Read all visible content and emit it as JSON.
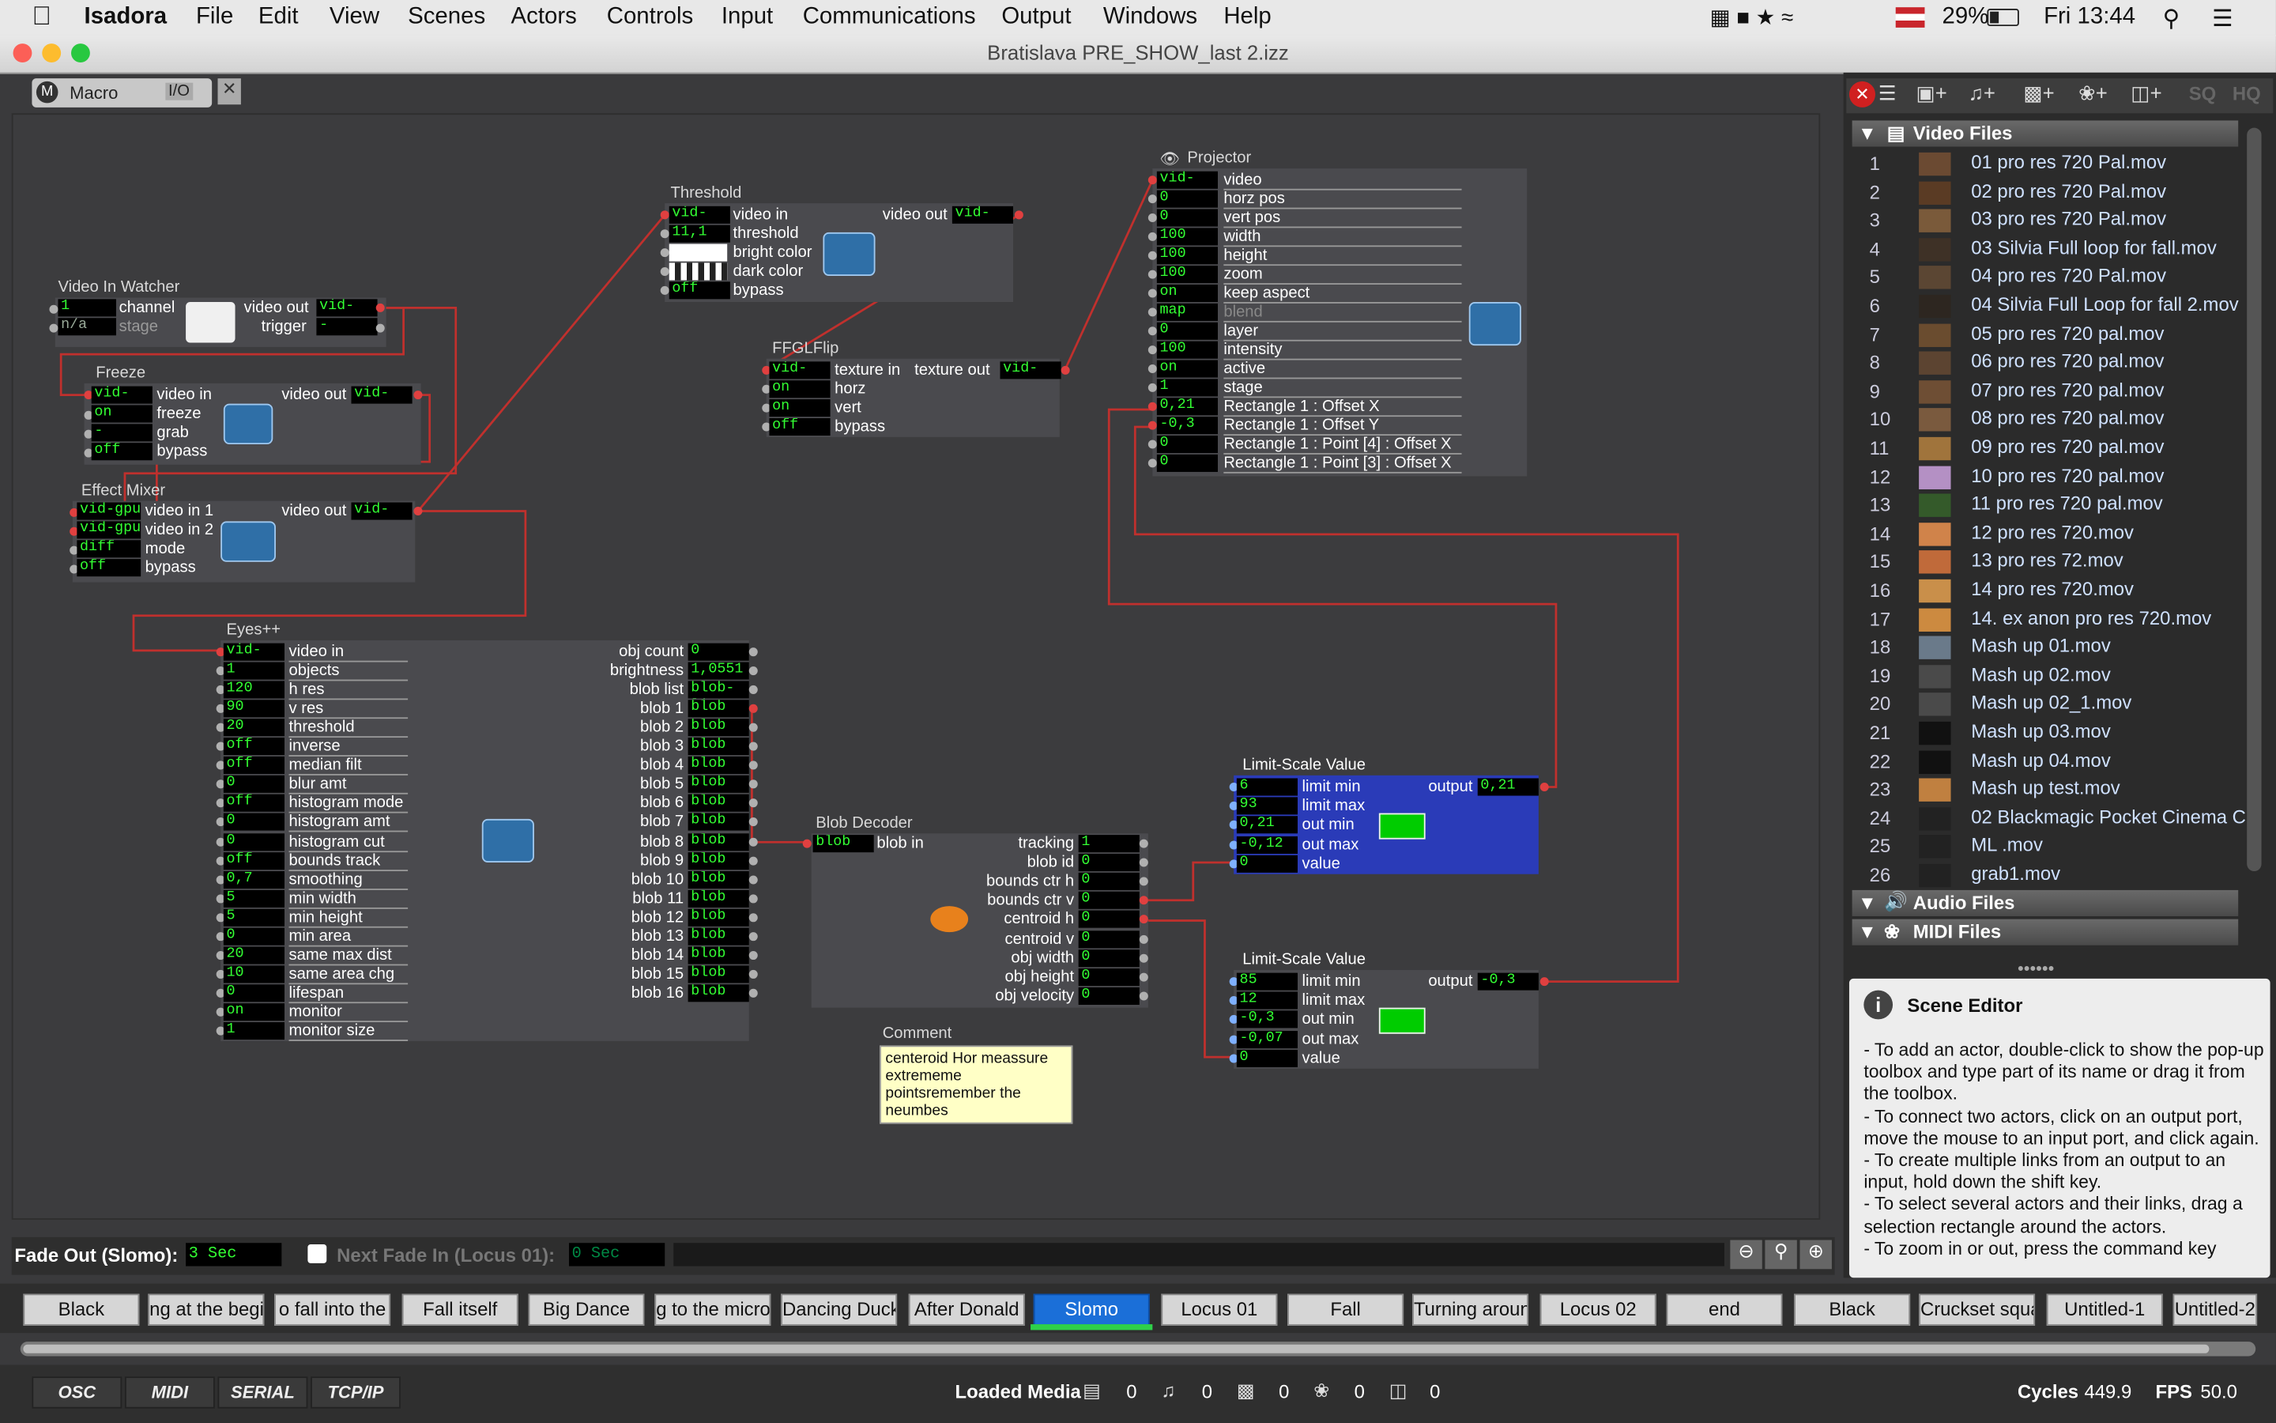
{
  "menubar": {
    "app": "Isadora",
    "items": [
      "File",
      "Edit",
      "View",
      "Scenes",
      "Actors",
      "Controls",
      "Input",
      "Communications",
      "Output",
      "Windows",
      "Help"
    ],
    "battery": "29%",
    "clock": "Fri 13:44"
  },
  "window": {
    "title": "Bratislava PRE_SHOW_last 2.izz"
  },
  "macro_tab": {
    "label": "Macro",
    "io": "I/O"
  },
  "actors": {
    "video_in_watcher": {
      "title": "Video In Watcher",
      "ch_val": "1",
      "ch_lbl": "channel",
      "stage_val": "n/a",
      "stage_lbl": "stage",
      "out_lbl": "video out",
      "out_val": "vid-gpu",
      "trig_lbl": "trigger",
      "trig_val": "-"
    },
    "freeze": {
      "title": "Freeze",
      "in_val": "vid-gpu",
      "in_lbl": "video in",
      "out_lbl": "video out",
      "out_val": "vid-gpu",
      "frz_val": "on",
      "frz_lbl": "freeze",
      "grab_val": "-",
      "grab_lbl": "grab",
      "byp_val": "off",
      "byp_lbl": "bypass"
    },
    "effect_mixer": {
      "title": "Effect Mixer",
      "in1_val": "vid-gpu",
      "in1_lbl": "video in 1",
      "in2_val": "vid-gpu",
      "in2_lbl": "video in 2",
      "mode_val": "diff",
      "mode_lbl": "mode",
      "byp_val": "off",
      "byp_lbl": "bypass",
      "out_lbl": "video out",
      "out_val": "vid-gpu"
    },
    "threshold": {
      "title": "Threshold",
      "in_val": "vid-gpu",
      "in_lbl": "video in",
      "thr_val": "11,1",
      "thr_lbl": "threshold",
      "bc_lbl": "bright color",
      "dc_lbl": "dark color",
      "byp_val": "off",
      "byp_lbl": "bypass",
      "out_lbl": "video out",
      "out_val": "vid-gpu"
    },
    "ffglflip": {
      "title": "FFGLFlip",
      "in_val": "vid-gpu",
      "in_lbl": "texture in",
      "h_val": "on",
      "h_lbl": "horz",
      "v_val": "on",
      "v_lbl": "vert",
      "byp_val": "off",
      "byp_lbl": "bypass",
      "out_lbl": "texture out",
      "out_val": "vid-gpu"
    },
    "projector": {
      "title": "Projector",
      "rows": [
        {
          "v": "vid-gpu",
          "l": "video"
        },
        {
          "v": "0",
          "l": "horz pos"
        },
        {
          "v": "0",
          "l": "vert pos"
        },
        {
          "v": "100",
          "l": "width"
        },
        {
          "v": "100",
          "l": "height"
        },
        {
          "v": "100",
          "l": "zoom"
        },
        {
          "v": "on",
          "l": "keep aspect"
        },
        {
          "v": "map",
          "l": "blend"
        },
        {
          "v": "0",
          "l": "layer"
        },
        {
          "v": "100",
          "l": "intensity"
        },
        {
          "v": "on",
          "l": "active"
        },
        {
          "v": "1",
          "l": "stage"
        },
        {
          "v": "0,21",
          "l": "Rectangle 1 : Offset X"
        },
        {
          "v": "-0,3",
          "l": "Rectangle 1 : Offset Y"
        },
        {
          "v": "0",
          "l": "Rectangle 1 : Point [4] : Offset X"
        },
        {
          "v": "0",
          "l": "Rectangle 1 : Point [3] : Offset X"
        }
      ]
    },
    "eyes": {
      "title": "Eyes++",
      "inputs": [
        {
          "v": "vid-gpu",
          "l": "video in"
        },
        {
          "v": "1",
          "l": "objects"
        },
        {
          "v": "120",
          "l": "h res"
        },
        {
          "v": "90",
          "l": "v res"
        },
        {
          "v": "20",
          "l": "threshold"
        },
        {
          "v": "off",
          "l": "inverse"
        },
        {
          "v": "off",
          "l": "median filt"
        },
        {
          "v": "0",
          "l": "blur amt"
        },
        {
          "v": "off",
          "l": "histogram mode"
        },
        {
          "v": "0",
          "l": "histogram amt"
        },
        {
          "v": "0",
          "l": "histogram cut"
        },
        {
          "v": "off",
          "l": "bounds track"
        },
        {
          "v": "0,7",
          "l": "smoothing"
        },
        {
          "v": "5",
          "l": "min width"
        },
        {
          "v": "5",
          "l": "min height"
        },
        {
          "v": "0",
          "l": "min area"
        },
        {
          "v": "20",
          "l": "same max dist"
        },
        {
          "v": "10",
          "l": "same area chg"
        },
        {
          "v": "0",
          "l": "lifespan"
        },
        {
          "v": "on",
          "l": "monitor"
        },
        {
          "v": "1",
          "l": "monitor size"
        }
      ],
      "outputs": [
        {
          "l": "obj count",
          "v": "0"
        },
        {
          "l": "brightness",
          "v": "1,0551"
        },
        {
          "l": "blob list",
          "v": "blob-list"
        },
        {
          "l": "blob 1",
          "v": "blob"
        },
        {
          "l": "blob 2",
          "v": "blob"
        },
        {
          "l": "blob 3",
          "v": "blob"
        },
        {
          "l": "blob 4",
          "v": "blob"
        },
        {
          "l": "blob 5",
          "v": "blob"
        },
        {
          "l": "blob 6",
          "v": "blob"
        },
        {
          "l": "blob 7",
          "v": "blob"
        },
        {
          "l": "blob 8",
          "v": "blob"
        },
        {
          "l": "blob 9",
          "v": "blob"
        },
        {
          "l": "blob 10",
          "v": "blob"
        },
        {
          "l": "blob 11",
          "v": "blob"
        },
        {
          "l": "blob 12",
          "v": "blob"
        },
        {
          "l": "blob 13",
          "v": "blob"
        },
        {
          "l": "blob 14",
          "v": "blob"
        },
        {
          "l": "blob 15",
          "v": "blob"
        },
        {
          "l": "blob 16",
          "v": "blob"
        }
      ]
    },
    "blob_decoder": {
      "title": "Blob Decoder",
      "in_val": "blob",
      "in_lbl": "blob in",
      "outputs": [
        {
          "l": "tracking",
          "v": "1"
        },
        {
          "l": "blob id",
          "v": "0"
        },
        {
          "l": "bounds ctr h",
          "v": "0"
        },
        {
          "l": "bounds ctr v",
          "v": "0"
        },
        {
          "l": "centroid h",
          "v": "0"
        },
        {
          "l": "centroid v",
          "v": "0"
        },
        {
          "l": "obj width",
          "v": "0"
        },
        {
          "l": "obj height",
          "v": "0"
        },
        {
          "l": "obj velocity",
          "v": "0"
        }
      ]
    },
    "limit_scale_1": {
      "title": "Limit-Scale Value",
      "rows": [
        {
          "v": "6",
          "l": "limit min"
        },
        {
          "v": "93",
          "l": "limit max"
        },
        {
          "v": "0,21",
          "l": "out min"
        },
        {
          "v": "-0,12",
          "l": "out max"
        },
        {
          "v": "0",
          "l": "value"
        }
      ],
      "out_lbl": "output",
      "out_val": "0,21"
    },
    "limit_scale_2": {
      "title": "Limit-Scale Value",
      "rows": [
        {
          "v": "85",
          "l": "limit min"
        },
        {
          "v": "12",
          "l": "limit max"
        },
        {
          "v": "-0,3",
          "l": "out min"
        },
        {
          "v": "-0,07",
          "l": "out max"
        },
        {
          "v": "0",
          "l": "value"
        }
      ],
      "out_lbl": "output",
      "out_val": "-0,3"
    },
    "comment": {
      "title": "Comment",
      "text": "centeroid Hor meassure extrememe pointsremember the neumbes"
    }
  },
  "fade": {
    "out_label": "Fade Out (Slomo):",
    "out_val": "3 Sec",
    "next_label": "Next Fade In (Locus 01):",
    "next_val": "0 Sec"
  },
  "media": {
    "video_header": "Video Files",
    "videos": [
      {
        "n": "1",
        "name": "01 pro res 720 Pal.mov"
      },
      {
        "n": "2",
        "name": "02 pro res 720 Pal.mov"
      },
      {
        "n": "3",
        "name": "03 pro res 720 Pal.mov"
      },
      {
        "n": "4",
        "name": "03 Silvia Full loop for fall.mov"
      },
      {
        "n": "5",
        "name": "04 pro res 720 Pal.mov"
      },
      {
        "n": "6",
        "name": "04 Silvia Full Loop for fall 2.mov"
      },
      {
        "n": "7",
        "name": "05 pro res 720 pal.mov"
      },
      {
        "n": "8",
        "name": "06 pro res 720 pal.mov"
      },
      {
        "n": "9",
        "name": "07 pro res 720 pal.mov"
      },
      {
        "n": "10",
        "name": "08 pro res 720 pal.mov"
      },
      {
        "n": "11",
        "name": "09 pro res 720 pal.mov"
      },
      {
        "n": "12",
        "name": "10 pro res 720 pal.mov"
      },
      {
        "n": "13",
        "name": "11 pro res 720 pal.mov"
      },
      {
        "n": "14",
        "name": "12 pro res 720.mov"
      },
      {
        "n": "15",
        "name": "13 pro res 72.mov"
      },
      {
        "n": "16",
        "name": "14 pro res 720.mov"
      },
      {
        "n": "17",
        "name": "14. ex anon pro res 720.mov"
      },
      {
        "n": "18",
        "name": "Mash up 01.mov"
      },
      {
        "n": "19",
        "name": "Mash up 02.mov"
      },
      {
        "n": "20",
        "name": "Mash up 02_1.mov"
      },
      {
        "n": "21",
        "name": "Mash up 03.mov"
      },
      {
        "n": "22",
        "name": "Mash up 04.mov"
      },
      {
        "n": "23",
        "name": "Mash up test.mov"
      },
      {
        "n": "24",
        "name": "02 Blackmagic Pocket Cinema C"
      },
      {
        "n": "25",
        "name": "ML .mov"
      },
      {
        "n": "26",
        "name": "grab1.mov"
      }
    ],
    "audio_header": "Audio Files",
    "midi_header": "MIDI Files",
    "toolbar": {
      "sq": "SQ",
      "hq": "HQ"
    }
  },
  "help": {
    "title": "Scene Editor",
    "text": "- To add an actor, double-click to show the pop-up toolbox and type part of its name or drag it from the toolbox.\n- To connect two actors, click on an output port, move the mouse to an input port, and click again.\n- To create multiple links from an output to an input, hold down the shift key.\n- To select several actors and their links, drag a selection rectangle around the actors.\n- To zoom in or out, press the command key"
  },
  "scenes": [
    "Black",
    "ng at the begin",
    "o fall into the",
    "Fall itself",
    "Big Dance",
    "g to the micro",
    "Dancing Duck",
    "After Donald",
    "Slomo",
    "Locus 01",
    "Fall",
    "Turning around",
    "Locus 02",
    "end",
    "Black",
    "Cruckset square",
    "Untitled-1",
    "Untitled-2"
  ],
  "active_scene": "Slomo",
  "bottom": {
    "buttons": [
      "OSC",
      "MIDI",
      "SERIAL",
      "TCP/IP"
    ],
    "loaded_media": "Loaded Media",
    "counts": [
      "0",
      "0",
      "0",
      "0",
      "0"
    ],
    "cycles_label": "Cycles",
    "cycles": "449.9",
    "fps_label": "FPS",
    "fps": "50.0"
  }
}
